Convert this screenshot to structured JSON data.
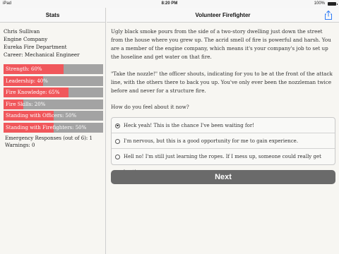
{
  "status_bar": {
    "carrier": "iPad",
    "time": "8:20 PM",
    "battery": "100%"
  },
  "sidebar": {
    "title": "Stats",
    "profile": {
      "name": "Chris Sullivan",
      "company": "Engine Company",
      "department": "Eureka Fire Department",
      "career": "Career: Mechanical Engineer"
    },
    "stats": [
      {
        "label": "Strength: 60%",
        "value": 60
      },
      {
        "label": "Leadership: 40%",
        "value": 40
      },
      {
        "label": "Fire Knowledge: 65%",
        "value": 65
      },
      {
        "label": "Fire Skills: 20%",
        "value": 20
      },
      {
        "label": "Standing with Officers: 50%",
        "value": 50
      },
      {
        "label": "Standing with Firefighters: 50%",
        "value": 50
      }
    ],
    "emergency_responses": "Emergency Responses (out of 6): 1",
    "warnings": "Warnings: 0"
  },
  "main": {
    "title": "Volunteer Firefighter",
    "paragraphs": [
      "Ugly black smoke pours from the side of a two-story dwelling just down the street from the house where you grew up. The acrid smell of fire is powerful and harsh. You are a member of the engine company, which means it's your company's job to set up the hoseline and get water on that fire.",
      "\"Take the nozzle!\" the officer shouts, indicating for you to be at the front of the attack line, with the others there to back you up. You've only ever been the nozzleman twice before and never for a structure fire."
    ],
    "question": "How do you feel about it now?",
    "choices": [
      {
        "label": "Heck yeah! This is the chance I've been waiting for!",
        "selected": true
      },
      {
        "label": "I'm nervous, but this is a good opportunity for me to gain experience.",
        "selected": false
      },
      {
        "label": "Hell no! I'm still just learning the ropes. If I mess up, someone could really get hurt!",
        "selected": false
      }
    ],
    "next_label": "Next"
  },
  "colors": {
    "stat_fill": "#f0575b",
    "stat_track": "#a3a3a3",
    "next_button": "#6a6a6a",
    "accent": "#2f7cf6"
  },
  "icons": {
    "share": "share-icon",
    "battery": "battery-icon",
    "radio": "radio-icon"
  }
}
